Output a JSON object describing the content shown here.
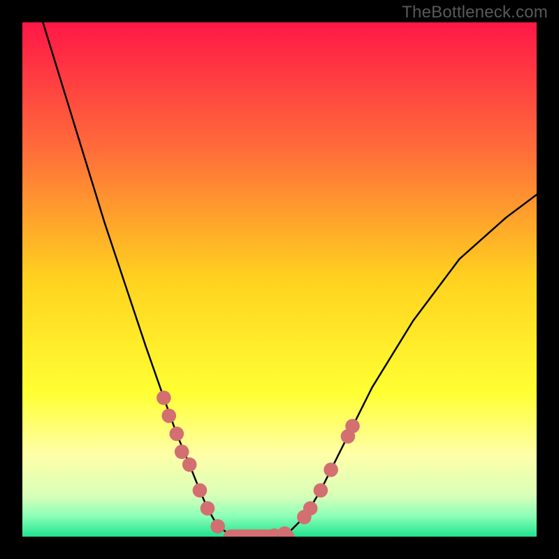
{
  "watermark": "TheBottleneck.com",
  "chart_data": {
    "type": "line",
    "title": "",
    "xlabel": "",
    "ylabel": "",
    "xlim": [
      0,
      1
    ],
    "ylim": [
      0,
      1
    ],
    "grid": false,
    "legend": false,
    "background_gradient": {
      "stops": [
        {
          "offset": 0.0,
          "color": "#ff1747"
        },
        {
          "offset": 0.25,
          "color": "#ff6e3a"
        },
        {
          "offset": 0.5,
          "color": "#ffd21f"
        },
        {
          "offset": 0.72,
          "color": "#ffff33"
        },
        {
          "offset": 0.84,
          "color": "#ffffa8"
        },
        {
          "offset": 0.92,
          "color": "#d8ffb8"
        },
        {
          "offset": 0.96,
          "color": "#8cffb8"
        },
        {
          "offset": 1.0,
          "color": "#20e38e"
        }
      ]
    },
    "series": [
      {
        "name": "bottleneck-curve",
        "color": "#000000",
        "x": [
          0.04,
          0.08,
          0.12,
          0.16,
          0.2,
          0.24,
          0.275,
          0.3,
          0.325,
          0.345,
          0.36,
          0.38,
          0.41,
          0.47,
          0.52,
          0.55,
          0.58,
          0.62,
          0.68,
          0.76,
          0.85,
          0.94,
          1.0
        ],
        "y": [
          1.0,
          0.87,
          0.74,
          0.61,
          0.49,
          0.37,
          0.27,
          0.2,
          0.14,
          0.09,
          0.055,
          0.02,
          0.0,
          0.0,
          0.01,
          0.04,
          0.09,
          0.17,
          0.29,
          0.42,
          0.54,
          0.62,
          0.665
        ]
      }
    ],
    "markers": [
      {
        "name": "left-cluster",
        "color": "#d36f70",
        "r": 0.014,
        "x": [
          0.275,
          0.285,
          0.3,
          0.31,
          0.325,
          0.345,
          0.36,
          0.38
        ],
        "y": [
          0.27,
          0.235,
          0.2,
          0.165,
          0.14,
          0.09,
          0.055,
          0.02
        ]
      },
      {
        "name": "trough",
        "color": "#d36f70",
        "r": 0.014,
        "x": [
          0.41,
          0.43,
          0.45,
          0.47,
          0.49,
          0.51
        ],
        "y": [
          0.0,
          0.0,
          0.0,
          0.0,
          0.002,
          0.006
        ]
      },
      {
        "name": "right-cluster",
        "color": "#d36f70",
        "r": 0.014,
        "x": [
          0.548,
          0.56,
          0.58,
          0.6,
          0.633,
          0.642
        ],
        "y": [
          0.038,
          0.055,
          0.09,
          0.13,
          0.195,
          0.215
        ]
      }
    ],
    "trough_band": {
      "color": "#d36f70",
      "x0": 0.405,
      "x1": 0.515,
      "y": 0.0,
      "thickness": 0.028
    }
  }
}
